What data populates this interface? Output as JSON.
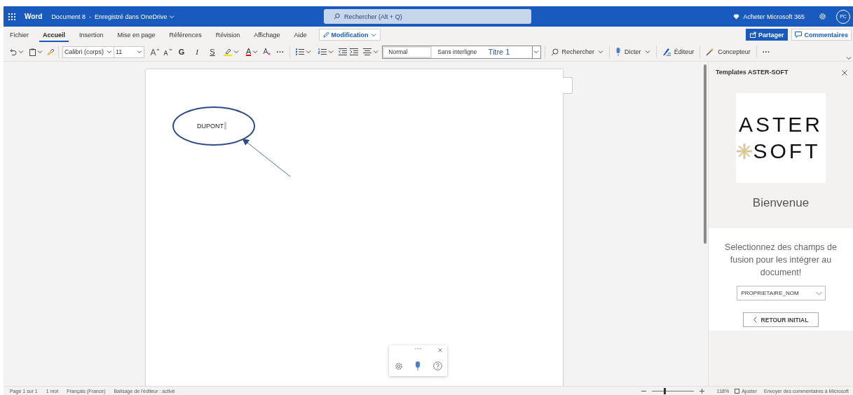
{
  "header": {
    "app_name": "Word",
    "document_title": "Document 8  -  Enregistré dans OneDrive",
    "search_placeholder": "Rechercher (Alt + Q)",
    "buy_label": "Acheter Microsoft 365",
    "avatar_initials": "PC"
  },
  "ribbon_tabs": [
    {
      "label": "Fichier",
      "selected": false
    },
    {
      "label": "Accueil",
      "selected": true
    },
    {
      "label": "Insertion",
      "selected": false
    },
    {
      "label": "Mise en page",
      "selected": false
    },
    {
      "label": "Références",
      "selected": false
    },
    {
      "label": "Révision",
      "selected": false
    },
    {
      "label": "Affichage",
      "selected": false
    },
    {
      "label": "Aide",
      "selected": false
    }
  ],
  "mode_button": "Modification",
  "share_button": "Partager",
  "comments_button": "Commentaires",
  "toolbar": {
    "font": "Calibri (corps)",
    "size": "11",
    "bold": "G",
    "italic": "I",
    "underline": "S",
    "font_color": "A",
    "more": "···"
  },
  "styles": [
    {
      "label": "Normal",
      "selected": true
    },
    {
      "label": "Sans interligne",
      "selected": false
    },
    {
      "label": "Titre 1",
      "selected": false
    }
  ],
  "tools": [
    {
      "kind": "search",
      "label": "Rechercher"
    },
    {
      "kind": "dictate",
      "label": "Dicter"
    },
    {
      "kind": "editor",
      "label": "Éditeur"
    },
    {
      "kind": "designer",
      "label": "Concepteur"
    }
  ],
  "tools_more": "···",
  "document": {
    "text": "DUPONT"
  },
  "side_pane": {
    "title": "Templates ASTER-SOFT",
    "logo_line_1": "ASTER",
    "logo_line_2": "SOFT",
    "welcome": "Bienvenue",
    "instruction": "Selectionnez des champs de fusion pour les intégrer au document!",
    "field_select": "PROPRIETAIRE_NOM",
    "back_button": "RETOUR INITIAL"
  },
  "status_bar": {
    "items": [
      "Page 1 sur 1",
      "1 mot",
      "Français (France)",
      "Balisage de l’éditeur : activé"
    ],
    "zoom": {
      "level": 0.3,
      "reading": "118%"
    },
    "fit": {
      "label": "Ajuster",
      "checked": false
    },
    "feedback": "Envoyer des commentaires à Microsoft"
  }
}
